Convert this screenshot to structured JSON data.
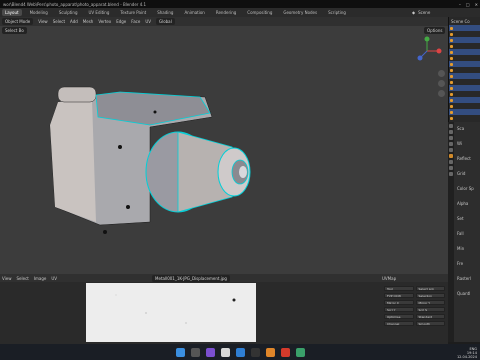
{
  "window": {
    "title": "wor\\Blend4 Web\\Pers\\photo_apparat\\photo_apparat.blend - Blender 4.1"
  },
  "workspaces": [
    "Layout",
    "Modeling",
    "Sculpting",
    "UV Editing",
    "Texture Paint",
    "Shading",
    "Animation",
    "Rendering",
    "Compositing",
    "Geometry Nodes",
    "Scripting"
  ],
  "active_workspace": "Layout",
  "scene": {
    "label": "Scene"
  },
  "viewport": {
    "menu": [
      "Object Mode",
      "View",
      "Select",
      "Add",
      "Mesh",
      "Vertex",
      "Edge",
      "Face",
      "UV"
    ],
    "orientation": "Global",
    "options_label": "Options",
    "select_box": "Select Bo"
  },
  "outliner": {
    "header": "Scene Co",
    "rows": 16
  },
  "properties": {
    "labels": [
      "Sca",
      "Wi",
      "Reflect",
      "Grid",
      "Color Sp",
      "Alpha",
      "Set",
      "Fall",
      "Min",
      "Fre",
      "Rasterl",
      "Quantl"
    ]
  },
  "image_editor": {
    "menu": [
      "View",
      "Select",
      "Image",
      "UV"
    ],
    "image_name": "Metall001_1K-JPG_Displacement.jpg"
  },
  "tool_panel": {
    "header": "UVMap",
    "items": [
      "Tool",
      "Select Lnk",
      "FVP OCW",
      "Seleclion",
      "Mirror X",
      "Mirror Y",
      "Scrl Y",
      "Scrl S",
      "Optimise",
      "Standard",
      "Channel",
      "Smooth"
    ]
  },
  "taskbar": {
    "time": "19:14",
    "date": "12.04.2024",
    "lang": "ENG"
  },
  "colors": {
    "accent": "#00d0d8",
    "selection": "#334d80",
    "workspace_active": "#4a4a4a"
  }
}
